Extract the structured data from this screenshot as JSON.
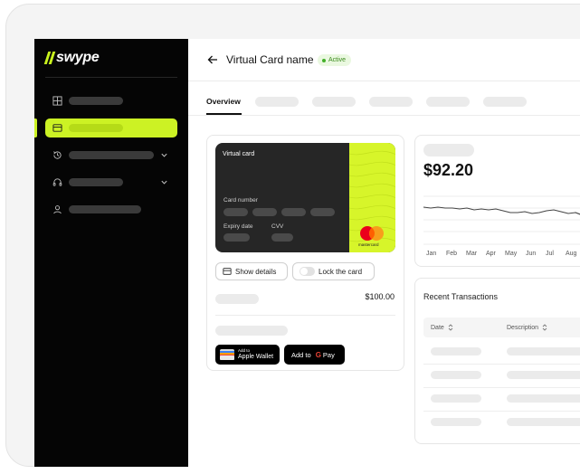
{
  "brand": {
    "name": "swype",
    "accent": "#ccf224"
  },
  "header": {
    "title": "Virtual Card name",
    "status": "Active"
  },
  "tabs": {
    "active_label": "Overview"
  },
  "card": {
    "title": "Virtual card",
    "number_label": "Card number",
    "expiry_label": "Expiry date",
    "cvv_label": "CVV",
    "network": "mastercard"
  },
  "actions": {
    "show_details": "Show details",
    "lock_card": "Lock the card"
  },
  "card_amount": "$100.00",
  "wallets": {
    "apple_small": "Add to",
    "apple_big": "Apple Wallet",
    "google_prefix": "Add to",
    "google_pay": "Pay"
  },
  "balance": {
    "amount": "$92.20",
    "months": [
      "Jan",
      "Feb",
      "Mar",
      "Apr",
      "May",
      "Jun",
      "Jul",
      "Aug"
    ]
  },
  "transactions": {
    "title": "Recent Transactions",
    "columns": [
      "Date",
      "Description"
    ]
  },
  "sidebar": {
    "icons": [
      "grid-icon",
      "card-icon",
      "history-icon",
      "headset-icon",
      "user-icon"
    ]
  }
}
